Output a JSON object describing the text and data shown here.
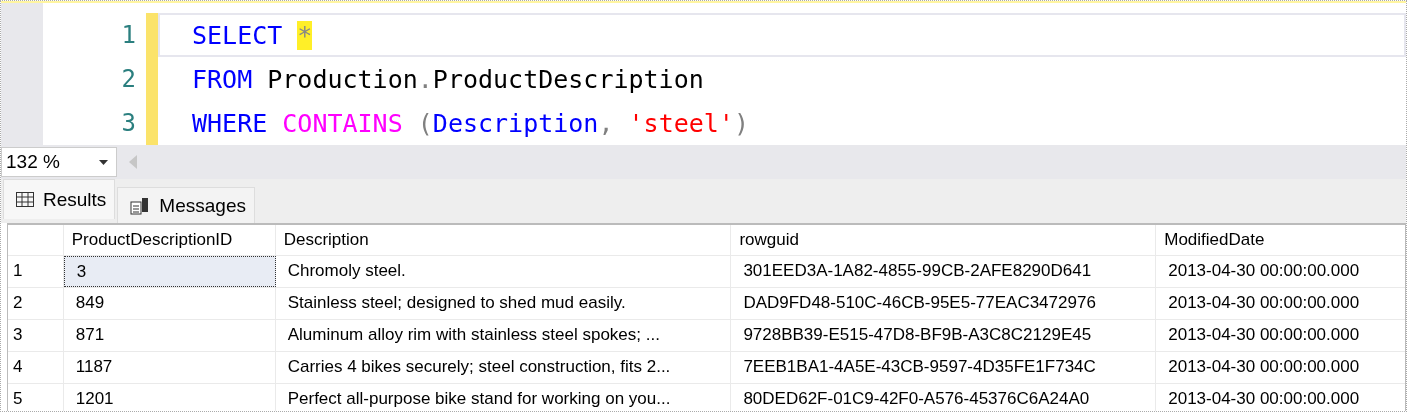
{
  "editor": {
    "lines": [
      {
        "number": "1",
        "current": true,
        "tokens": [
          {
            "kind": "keyword",
            "text": "SELECT "
          },
          {
            "kind": "highlight",
            "text": "*"
          }
        ]
      },
      {
        "number": "2",
        "current": false,
        "tokens": [
          {
            "kind": "keyword",
            "text": "FROM "
          },
          {
            "kind": "ident",
            "text": "Production"
          },
          {
            "kind": "punct",
            "text": "."
          },
          {
            "kind": "ident",
            "text": "ProductDescription"
          }
        ]
      },
      {
        "number": "3",
        "current": false,
        "tokens": [
          {
            "kind": "keyword",
            "text": "WHERE "
          },
          {
            "kind": "function",
            "text": "CONTAINS "
          },
          {
            "kind": "punct",
            "text": "("
          },
          {
            "kind": "keyword",
            "text": "Description"
          },
          {
            "kind": "punct",
            "text": ", "
          },
          {
            "kind": "string",
            "text": "'steel'"
          },
          {
            "kind": "punct",
            "text": ")"
          }
        ]
      }
    ]
  },
  "zoom": {
    "value": "132 %"
  },
  "tabs": [
    {
      "label": "Results",
      "selected": true
    },
    {
      "label": "Messages",
      "selected": false
    }
  ],
  "table": {
    "columns": [
      "ProductDescriptionID",
      "Description",
      "rowguid",
      "ModifiedDate"
    ],
    "rows": [
      {
        "number": "1",
        "selected": true,
        "cells": [
          "3",
          "Chromoly steel.",
          "301EED3A-1A82-4855-99CB-2AFE8290D641",
          "2013-04-30 00:00:00.000"
        ]
      },
      {
        "number": "2",
        "selected": false,
        "cells": [
          "849",
          "Stainless steel; designed to shed mud easily.",
          "DAD9FD48-510C-46CB-95E5-77EAC3472976",
          "2013-04-30 00:00:00.000"
        ]
      },
      {
        "number": "3",
        "selected": false,
        "cells": [
          "871",
          "Aluminum alloy rim with stainless steel spokes; ...",
          "9728BB39-E515-47D8-BF9B-A3C8C2129E45",
          "2013-04-30 00:00:00.000"
        ]
      },
      {
        "number": "4",
        "selected": false,
        "cells": [
          "1187",
          "Carries 4 bikes securely; steel construction, fits 2...",
          "7EEB1BA1-4A5E-43CB-9597-4D35FE1F734C",
          "2013-04-30 00:00:00.000"
        ]
      },
      {
        "number": "5",
        "selected": false,
        "cells": [
          "1201",
          "Perfect all-purpose bike stand for working on you...",
          "80DED62F-01C9-42F0-A576-45376C6A24A0",
          "2013-04-30 00:00:00.000"
        ]
      }
    ]
  }
}
